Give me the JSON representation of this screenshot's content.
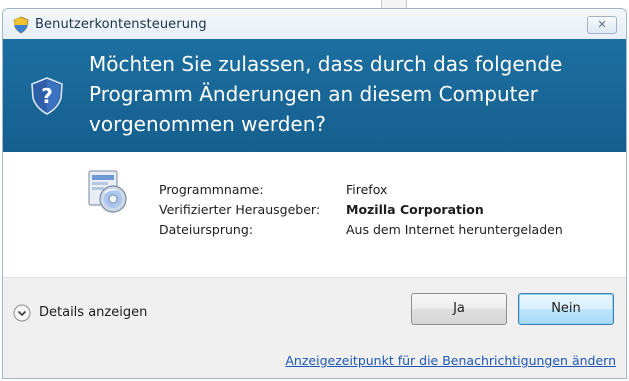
{
  "window": {
    "title": "Benutzerkontensteuerung",
    "close_glyph": "✕"
  },
  "header": {
    "line1": "Möchten Sie zulassen, dass durch das folgende",
    "line2": "Programm Änderungen an diesem Computer",
    "line3": "vorgenommen werden?",
    "icon": "uac-shield-icon"
  },
  "program": {
    "icon": "setup-disc-icon",
    "rows": [
      {
        "label": "Programmname:",
        "value": "Firefox",
        "bold": false
      },
      {
        "label": "Verifizierter Herausgeber:",
        "value": "Mozilla Corporation",
        "bold": true
      },
      {
        "label": "Dateiursprung:",
        "value": "Aus dem Internet heruntergeladen",
        "bold": false
      }
    ]
  },
  "footer": {
    "details_label": "Details anzeigen",
    "yes_label": "Ja",
    "no_label": "Nein",
    "link_label": "Anzeigezeitpunkt für die Benachrichtigungen ändern"
  },
  "colors": {
    "header_bg": "#1c6fa1",
    "link": "#1e57b5",
    "default_button_border": "#3c7fb1"
  }
}
